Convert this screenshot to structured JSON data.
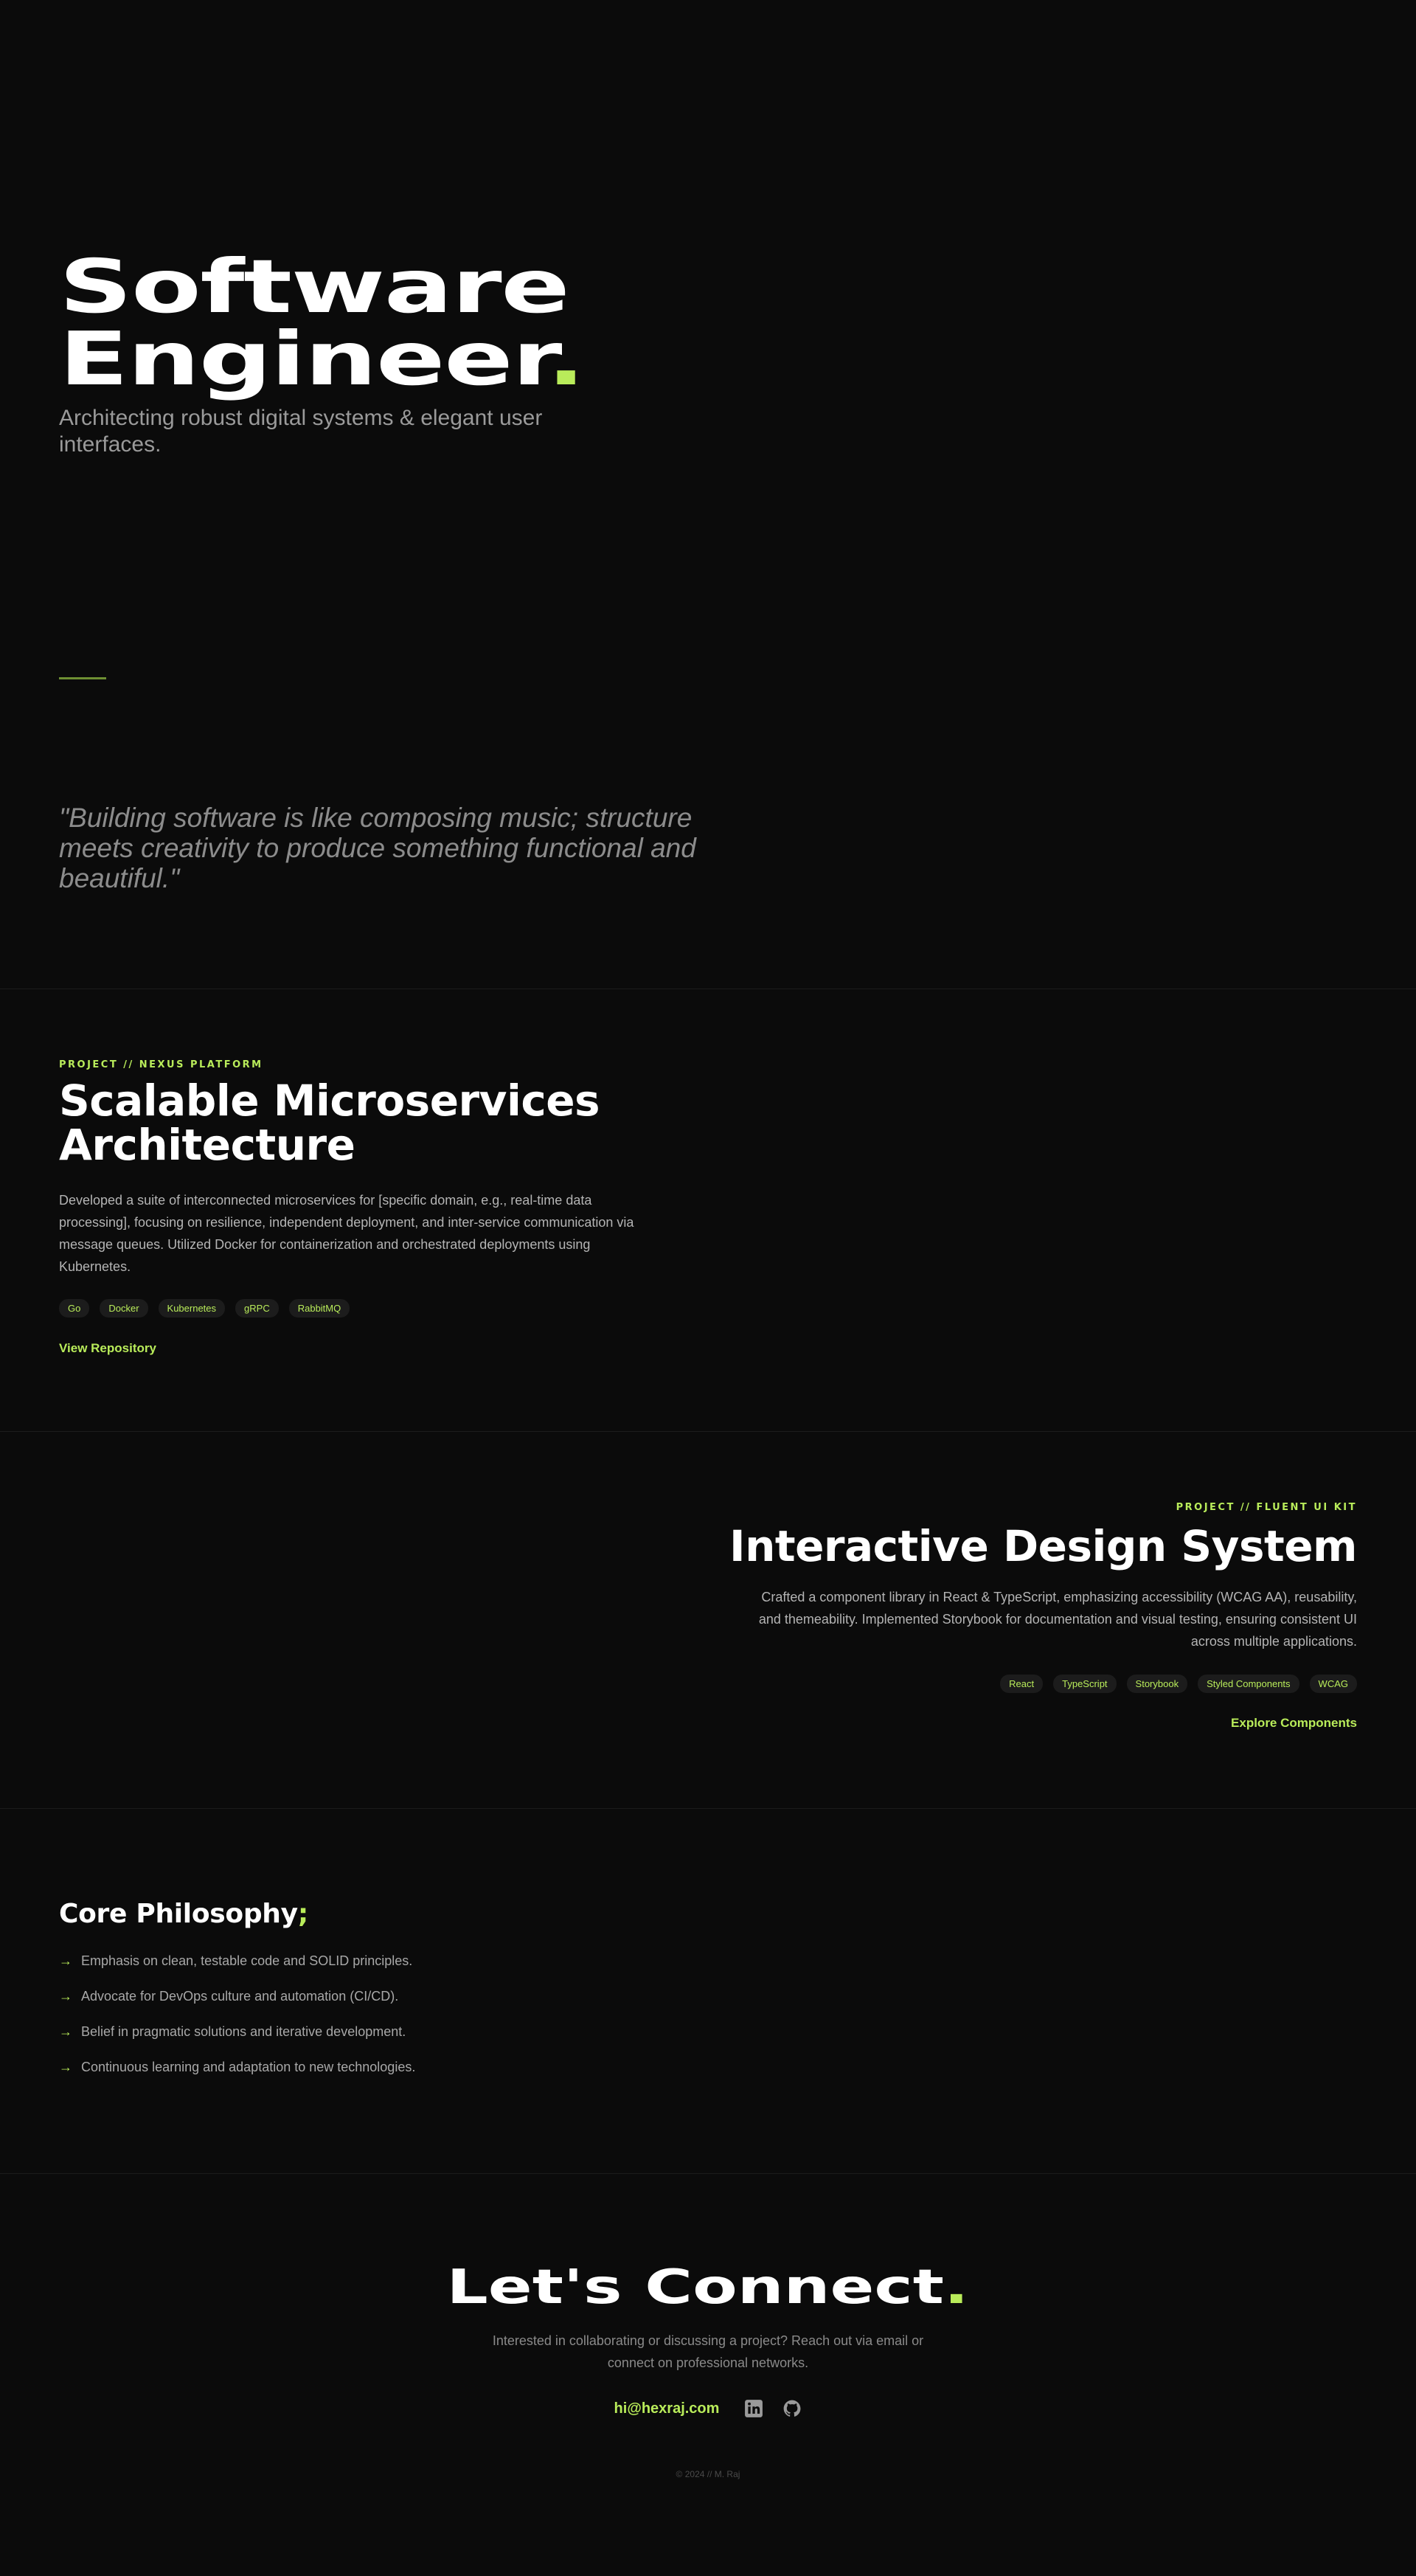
{
  "hero": {
    "title_line1": "Software",
    "title_line2": "Engineer",
    "title_dot": ".",
    "subtitle": "Architecting robust digital systems & elegant user interfaces.",
    "quote": "\"Building software is like composing music; structure meets creativity to produce something functional and beautiful.\""
  },
  "projects": [
    {
      "eyebrow": "PROJECT // NEXUS PLATFORM",
      "title": "Scalable Microservices Architecture",
      "description": "Developed a suite of interconnected microservices for [specific domain, e.g., real-time data processing], focusing on resilience, independent deployment, and inter-service communication via message queues. Utilized Docker for containerization and orchestrated deployments using Kubernetes.",
      "tags": [
        "Go",
        "Docker",
        "Kubernetes",
        "gRPC",
        "RabbitMQ"
      ],
      "link": "View Repository"
    },
    {
      "eyebrow": "PROJECT // FLUENT UI KIT",
      "title": "Interactive Design System",
      "description": "Crafted a component library in React & TypeScript, emphasizing accessibility (WCAG AA), reusability, and themeability. Implemented Storybook for documentation and visual testing, ensuring consistent UI across multiple applications.",
      "tags": [
        "React",
        "TypeScript",
        "Storybook",
        "Styled Components",
        "WCAG"
      ],
      "link": "Explore Components"
    }
  ],
  "philosophy": {
    "title": "Core Philosophy",
    "title_mark": ";",
    "arrow": "→",
    "items": [
      "Emphasis on clean, testable code and SOLID principles.",
      "Advocate for DevOps culture and automation (CI/CD).",
      "Belief in pragmatic solutions and iterative development.",
      "Continuous learning and adaptation to new technologies."
    ]
  },
  "connect": {
    "title": "Let's Connect",
    "title_dot": ".",
    "subtitle": "Interested in collaborating or discussing a project? Reach out via email or connect on professional networks.",
    "email": "hi@hexraj.com",
    "social_icons": [
      "linkedin-icon",
      "github-icon"
    ]
  },
  "footer": {
    "text": "© 2024 // M. Raj"
  },
  "colors": {
    "accent": "#b9ec5a",
    "background": "#0b0b0b",
    "muted": "#8c8c8c"
  }
}
